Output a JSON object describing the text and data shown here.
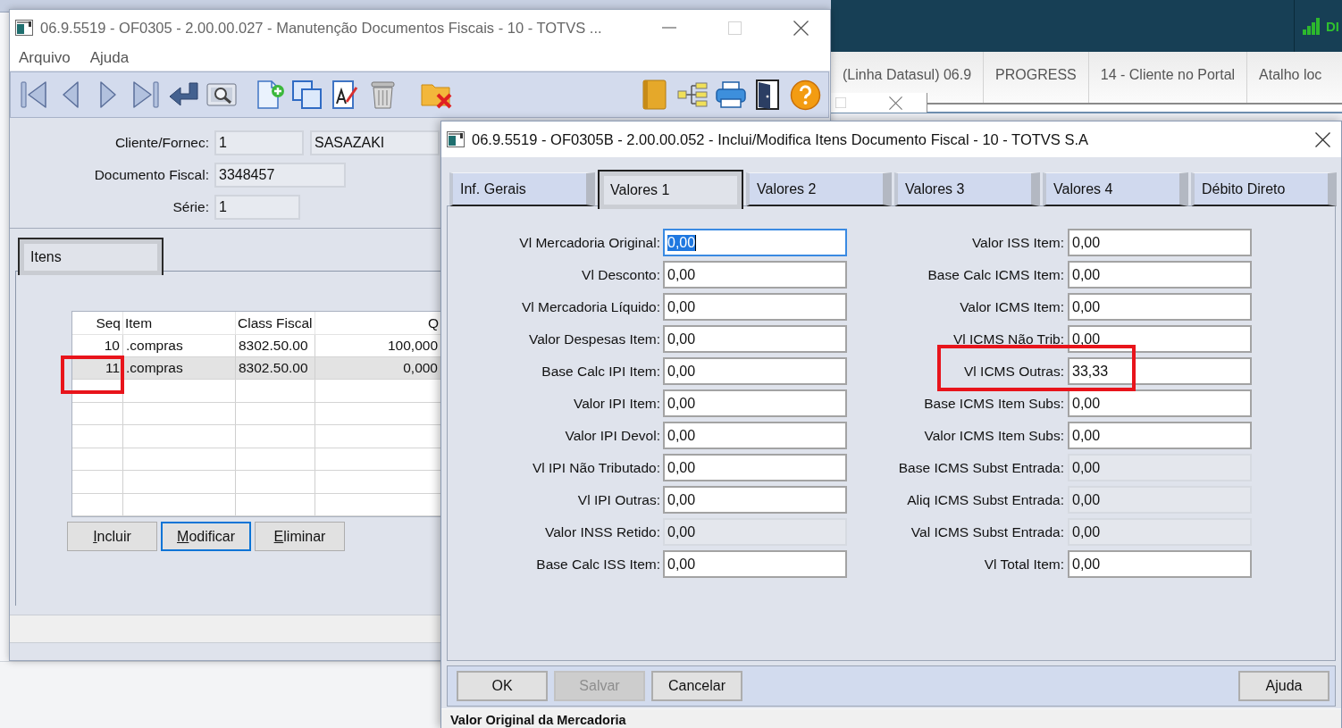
{
  "background_app": {
    "network_label": "DI",
    "tabs": [
      {
        "label": "(Linha Datasul) 06.9",
        "selected": false
      },
      {
        "label": "PROGRESS",
        "selected": false
      },
      {
        "label": "14 - Cliente no Portal",
        "selected": false
      },
      {
        "label": "Atalho loc",
        "selected": false
      }
    ]
  },
  "main_window": {
    "title": "06.9.5519 - OF0305 - 2.00.00.027 - Manutenção Documentos Fiscais - 10 - TOTVS ...",
    "menu": [
      "Arquivo",
      "Ajuda"
    ],
    "fields": [
      {
        "label": "Cliente/Fornec:",
        "values": [
          "1",
          "SASAZAKI"
        ]
      },
      {
        "label": "Documento Fiscal:",
        "values": [
          "3348457"
        ]
      },
      {
        "label": "Série:",
        "values": [
          "1"
        ]
      }
    ],
    "tabs": [
      {
        "label": "Itens",
        "selected": true
      }
    ],
    "items_table": {
      "columns": [
        "Seq",
        "Item",
        "Class Fiscal",
        "Q"
      ],
      "rows": [
        {
          "cells": [
            "10",
            ".compras",
            "8302.50.00",
            "100,000"
          ],
          "selected": false,
          "marked": false
        },
        {
          "cells": [
            "11",
            ".compras",
            "8302.50.00",
            "0,000"
          ],
          "selected": true,
          "marked": true
        }
      ]
    },
    "buttons": [
      {
        "label": "Incluir",
        "focused": false
      },
      {
        "label": "Modificar",
        "focused": true
      },
      {
        "label": "Eliminar",
        "focused": false
      }
    ]
  },
  "dialog": {
    "title": "06.9.5519 - OF0305B - 2.00.00.052 - Inclui/Modifica Itens Documento Fiscal - 10 - TOTVS S.A",
    "tabs": [
      {
        "label": "Inf. Gerais",
        "selected": false
      },
      {
        "label": "Valores 1",
        "selected": true
      },
      {
        "label": "Valores 2",
        "selected": false
      },
      {
        "label": "Valores 3",
        "selected": false
      },
      {
        "label": "Valores 4",
        "selected": false
      },
      {
        "label": "Débito Direto",
        "selected": false
      }
    ],
    "fields_left": [
      {
        "label": "Vl Mercadoria Original:",
        "value": "0,00",
        "focused": true,
        "disabled": false,
        "marked": false
      },
      {
        "label": "Vl Desconto:",
        "value": "0,00",
        "focused": false,
        "disabled": false,
        "marked": false
      },
      {
        "label": "Vl Mercadoria Líquido:",
        "value": "0,00",
        "focused": false,
        "disabled": false,
        "marked": false
      },
      {
        "label": "Valor Despesas Item:",
        "value": "0,00",
        "focused": false,
        "disabled": false,
        "marked": false
      },
      {
        "label": "Base Calc IPI Item:",
        "value": "0,00",
        "focused": false,
        "disabled": false,
        "marked": false
      },
      {
        "label": "Valor IPI Item:",
        "value": "0,00",
        "focused": false,
        "disabled": false,
        "marked": false
      },
      {
        "label": "Valor IPI Devol:",
        "value": "0,00",
        "focused": false,
        "disabled": false,
        "marked": false
      },
      {
        "label": "Vl IPI Não Tributado:",
        "value": "0,00",
        "focused": false,
        "disabled": false,
        "marked": false
      },
      {
        "label": "Vl IPI Outras:",
        "value": "0,00",
        "focused": false,
        "disabled": false,
        "marked": false
      },
      {
        "label": "Valor INSS Retido:",
        "value": "0,00",
        "focused": false,
        "disabled": true,
        "marked": false
      },
      {
        "label": "Base Calc ISS Item:",
        "value": "0,00",
        "focused": false,
        "disabled": false,
        "marked": false
      }
    ],
    "fields_right": [
      {
        "label": "Valor ISS Item:",
        "value": "0,00",
        "focused": false,
        "disabled": false,
        "marked": false
      },
      {
        "label": "Base Calc ICMS Item:",
        "value": "0,00",
        "focused": false,
        "disabled": false,
        "marked": false
      },
      {
        "label": "Valor ICMS Item:",
        "value": "0,00",
        "focused": false,
        "disabled": false,
        "marked": false
      },
      {
        "label": "Vl ICMS Não Trib:",
        "value": "0,00",
        "focused": false,
        "disabled": false,
        "marked": false
      },
      {
        "label": "Vl ICMS Outras:",
        "value": "33,33",
        "focused": false,
        "disabled": false,
        "marked": true
      },
      {
        "label": "Base ICMS Item Subs:",
        "value": "0,00",
        "focused": false,
        "disabled": false,
        "marked": false
      },
      {
        "label": "Valor ICMS Item Subs:",
        "value": "0,00",
        "focused": false,
        "disabled": false,
        "marked": false
      },
      {
        "label": "Base ICMS Subst Entrada:",
        "value": "0,00",
        "focused": false,
        "disabled": true,
        "marked": false
      },
      {
        "label": "Aliq ICMS Subst Entrada:",
        "value": "0,00",
        "focused": false,
        "disabled": true,
        "marked": false
      },
      {
        "label": "Val ICMS Subst Entrada:",
        "value": "0,00",
        "focused": false,
        "disabled": true,
        "marked": false
      },
      {
        "label": "Vl Total Item:",
        "value": "0,00",
        "focused": false,
        "disabled": false,
        "marked": false
      }
    ],
    "buttons": [
      {
        "label": "OK",
        "disabled": false
      },
      {
        "label": "Salvar",
        "disabled": true
      },
      {
        "label": "Cancelar",
        "disabled": false
      }
    ],
    "help_button": {
      "label": "Ajuda",
      "disabled": false
    },
    "status_text": "Valor Original da Mercadoria"
  }
}
